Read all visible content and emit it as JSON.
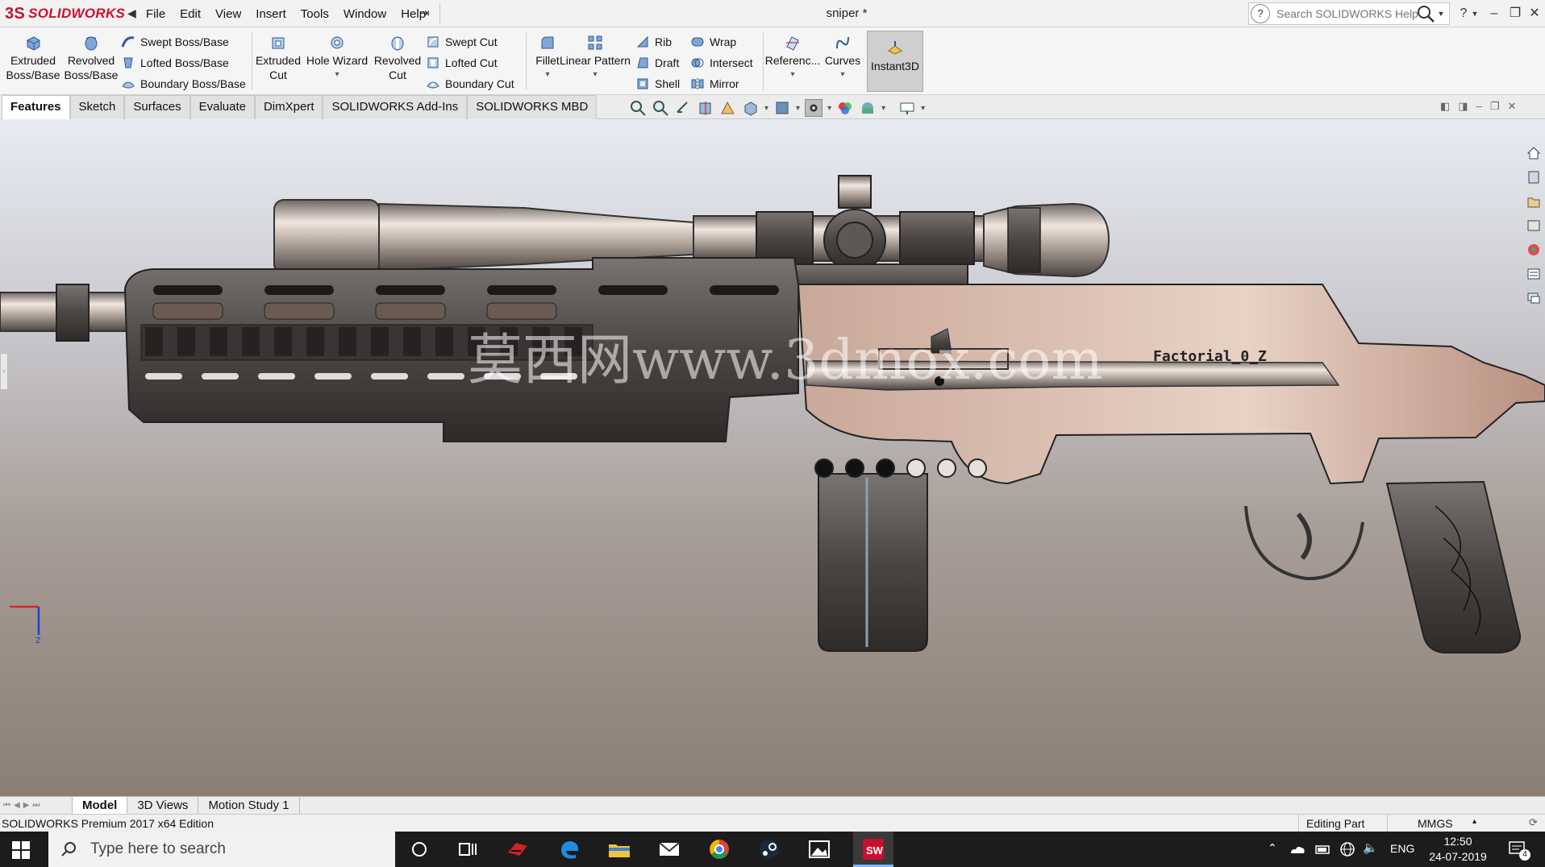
{
  "app": {
    "brand_ds": "3S",
    "brand_name": "SOLIDWORKS",
    "document_title": "sniper *"
  },
  "menu": {
    "items": [
      "File",
      "Edit",
      "View",
      "Insert",
      "Tools",
      "Window",
      "Help"
    ]
  },
  "search": {
    "placeholder": "Search SOLIDWORKS Help"
  },
  "toolbar": {
    "extruded_boss_l1": "Extruded",
    "extruded_boss_l2": "Boss/Base",
    "revolved_boss_l1": "Revolved",
    "revolved_boss_l2": "Boss/Base",
    "swept_boss": "Swept Boss/Base",
    "lofted_boss": "Lofted Boss/Base",
    "boundary_boss": "Boundary Boss/Base",
    "extruded_cut_l1": "Extruded",
    "extruded_cut_l2": "Cut",
    "hole_wizard": "Hole Wizard",
    "revolved_cut_l1": "Revolved",
    "revolved_cut_l2": "Cut",
    "swept_cut": "Swept Cut",
    "lofted_cut": "Lofted Cut",
    "boundary_cut": "Boundary Cut",
    "fillet": "Fillet",
    "linear_pattern": "Linear Pattern",
    "rib": "Rib",
    "draft": "Draft",
    "shell": "Shell",
    "wrap": "Wrap",
    "intersect": "Intersect",
    "mirror": "Mirror",
    "reference": "Referenc...",
    "curves": "Curves",
    "instant3d": "Instant3D"
  },
  "tabs": [
    "Features",
    "Sketch",
    "Surfaces",
    "Evaluate",
    "DimXpert",
    "SOLIDWORKS Add-Ins",
    "SOLIDWORKS MBD"
  ],
  "viewport": {
    "watermark": "莫西网www.3dmox.com",
    "model_text": "Factorial_0_Z",
    "triad_axis_z": "Z"
  },
  "bottom_tabs": [
    "Model",
    "3D Views",
    "Motion Study 1"
  ],
  "status": {
    "edition": "SOLIDWORKS Premium 2017 x64 Edition",
    "mode": "Editing Part",
    "units": "MMGS"
  },
  "taskbar": {
    "search_placeholder": "Type here to search",
    "lang": "ENG",
    "time": "12:50",
    "date": "24-07-2019",
    "notifications": "4"
  },
  "colors": {
    "brand": "#c8102e",
    "taskbar": "#1c1c1c",
    "accent_blue": "#1f6fd1"
  }
}
